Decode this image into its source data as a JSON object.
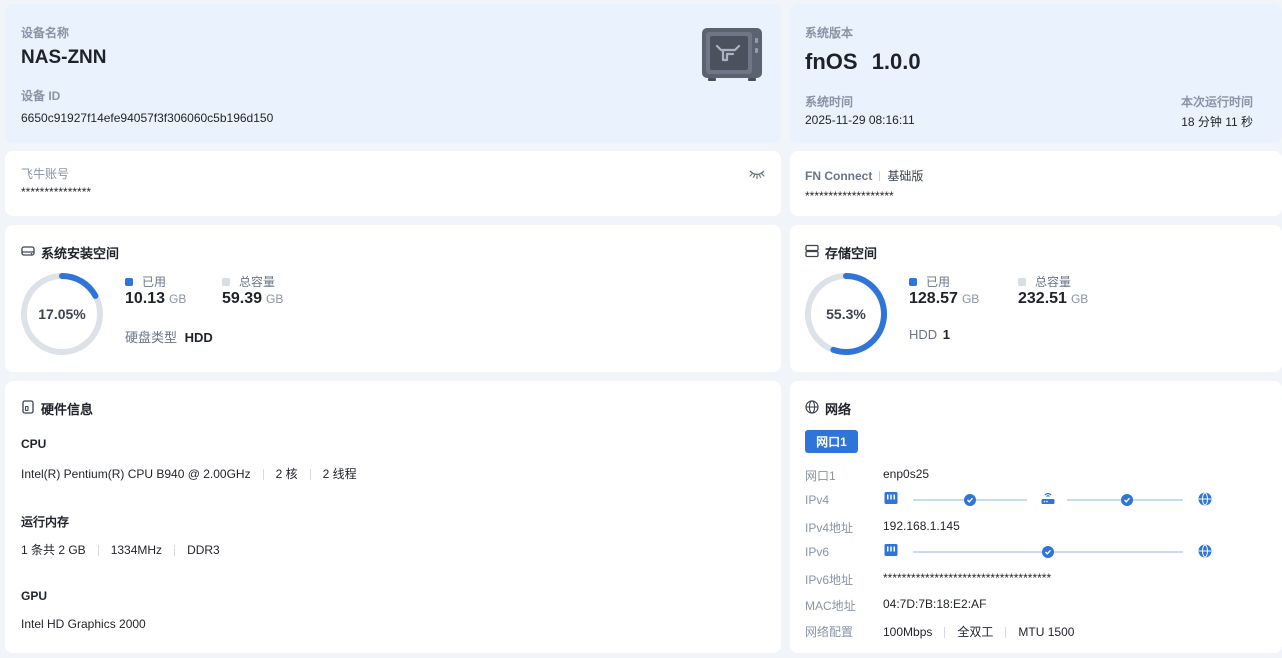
{
  "device": {
    "name_label": "设备名称",
    "name": "NAS-ZNN",
    "id_label": "设备 ID",
    "id": "6650c91927f14efe94057f3f306060c5b196d150"
  },
  "system": {
    "version_label": "系统版本",
    "os_name": "fnOS",
    "os_version": "1.0.0",
    "time_label": "系统时间",
    "time": "2025-11-29 08:16:11",
    "uptime_label": "本次运行时间",
    "uptime": "18 分钟 11 秒"
  },
  "account": {
    "label": "飞牛账号",
    "value": "***************"
  },
  "fnconnect": {
    "label": "FN Connect",
    "tier": "基础版",
    "value": "*******************"
  },
  "sys_space": {
    "title": "系统安装空间",
    "percent": 17.05,
    "percent_text": "17.05%",
    "used_label": "已用",
    "used_value": "10.13",
    "used_unit": "GB",
    "total_label": "总容量",
    "total_value": "59.39",
    "total_unit": "GB",
    "disk_type_label": "硬盘类型",
    "disk_type": "HDD"
  },
  "storage": {
    "title": "存储空间",
    "percent": 55.3,
    "percent_text": "55.3%",
    "used_label": "已用",
    "used_value": "128.57",
    "used_unit": "GB",
    "total_label": "总容量",
    "total_value": "232.51",
    "total_unit": "GB",
    "hdd_label": "HDD",
    "hdd_count": "1"
  },
  "hardware": {
    "title": "硬件信息",
    "cpu_label": "CPU",
    "cpu_model": "Intel(R) Pentium(R) CPU B940 @ 2.00GHz",
    "cpu_cores": "2 核",
    "cpu_threads": "2 线程",
    "mem_label": "运行内存",
    "mem_size": "1 条共 2 GB",
    "mem_freq": "1334MHz",
    "mem_type": "DDR3",
    "gpu_label": "GPU",
    "gpu_model": "Intel HD Graphics 2000"
  },
  "network": {
    "title": "网络",
    "port_tab": "网口1",
    "port_label": "网口1",
    "port_value": "enp0s25",
    "ipv4_label": "IPv4",
    "ipv4_addr_label": "IPv4地址",
    "ipv4_addr": "192.168.1.145",
    "ipv6_label": "IPv6",
    "ipv6_addr_label": "IPv6地址",
    "ipv6_addr": "************************************",
    "mac_label": "MAC地址",
    "mac": "04:7D:7B:18:E2:AF",
    "config_label": "网络配置",
    "speed": "100Mbps",
    "duplex": "全双工",
    "mtu": "MTU 1500"
  },
  "colors": {
    "accent": "#2f74d8",
    "ring_track": "#dde1e8",
    "card_blue": "#eaf2fd"
  }
}
